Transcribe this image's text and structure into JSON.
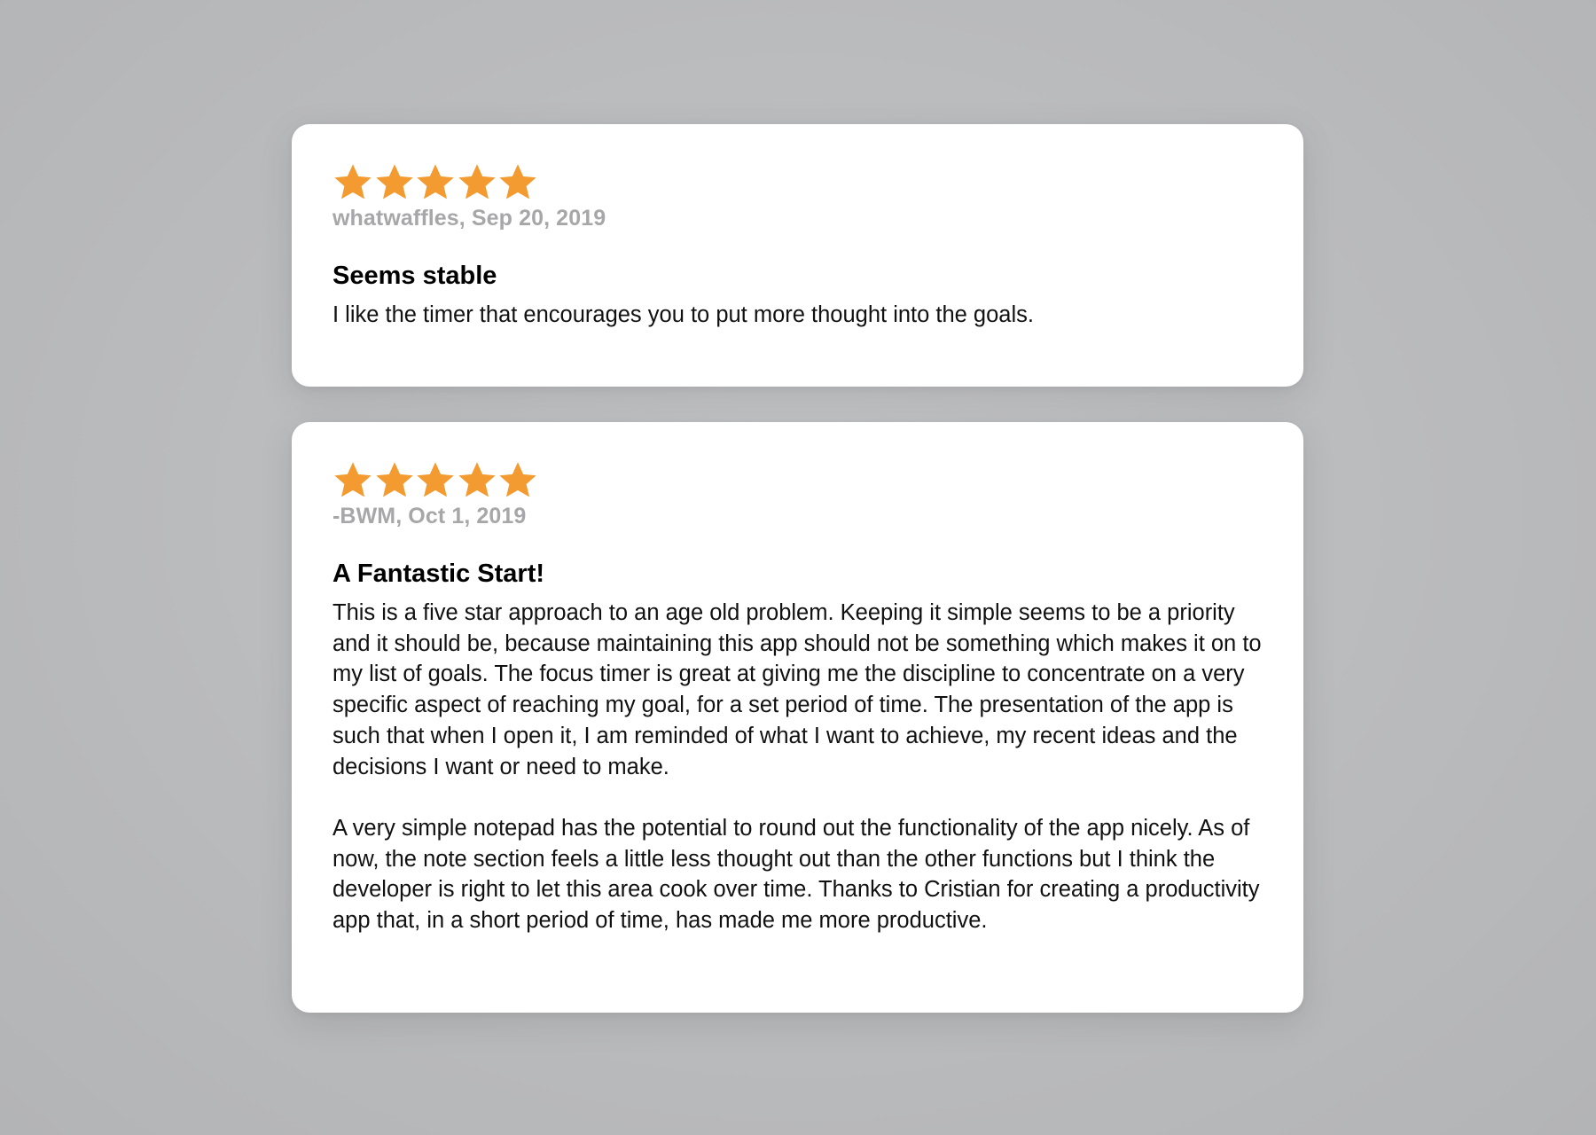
{
  "colors": {
    "star": "#f39b30",
    "meta": "#a7a7a9",
    "card": "#ffffff",
    "background": "#bcbdc0"
  },
  "reviews": [
    {
      "rating": 5,
      "author_date": "whatwaffles, Sep 20, 2019",
      "title": "Seems stable",
      "paragraphs": [
        "I like the timer that encourages you to put more thought into the goals."
      ]
    },
    {
      "rating": 5,
      "author_date": "-BWM, Oct 1, 2019",
      "title": "A Fantastic Start!",
      "paragraphs": [
        "This is a five star approach to an age old problem. Keeping it simple seems to be a priority and it should be, because maintaining this app should not be something which makes it on to my list of goals. The focus timer is great at giving me the discipline to concentrate on a very specific aspect of reaching my goal, for a set period of time. The presentation of the app is such that when I open it, I am reminded of what I want to achieve, my recent ideas and the decisions I want or need to make.",
        "A very simple notepad has the potential to round out the functionality of the app nicely. As of now, the note section feels a little less thought out than the other functions but I think the developer is right to let this area cook over time. Thanks to Cristian for creating a productivity app that, in a short period of time, has made me more productive."
      ]
    }
  ]
}
